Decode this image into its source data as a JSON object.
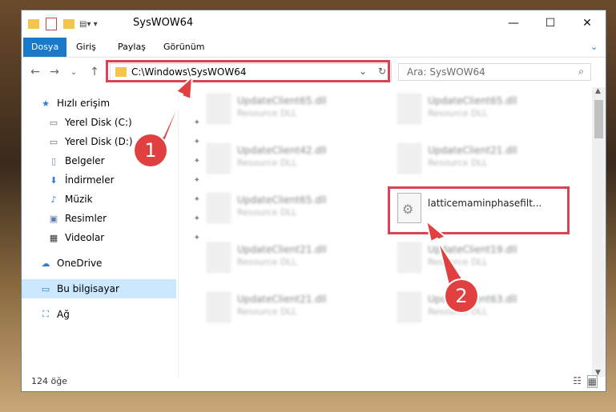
{
  "window": {
    "title": "SysWOW64"
  },
  "ribbon": {
    "tabs": [
      "Dosya",
      "Giriş",
      "Paylaş",
      "Görünüm"
    ]
  },
  "address": {
    "path": "C:\\Windows\\SysWOW64"
  },
  "search": {
    "placeholder": "Ara: SysWOW64"
  },
  "sidebar": {
    "items": [
      {
        "label": "Hızlı erişim"
      },
      {
        "label": "Yerel Disk (C:)"
      },
      {
        "label": "Yerel Disk (D:)"
      },
      {
        "label": "Belgeler"
      },
      {
        "label": "İndirmeler"
      },
      {
        "label": "Müzik"
      },
      {
        "label": "Resimler"
      },
      {
        "label": "Videolar"
      },
      {
        "label": "OneDrive"
      },
      {
        "label": "Bu bilgisayar"
      },
      {
        "label": "Ağ"
      }
    ]
  },
  "files": [
    {
      "name": "UpdateClient65.dll",
      "desc": "Resource DLL"
    },
    {
      "name": "UpdateClient65.dll",
      "desc": "Resource DLL"
    },
    {
      "name": "UpdateClient42.dll",
      "desc": "Resource DLL"
    },
    {
      "name": "UpdateClient21.dll",
      "desc": "Resource DLL"
    },
    {
      "name": "UpdateClient65.dll",
      "desc": "Resource DLL"
    },
    {
      "name": "latticemaminphasefilt...",
      "desc": ""
    },
    {
      "name": "UpdateClient21.dll",
      "desc": "Resource DLL"
    },
    {
      "name": "UpdateClient19.dll",
      "desc": "Resource DLL"
    },
    {
      "name": "UpdateClient21.dll",
      "desc": "Resource DLL"
    },
    {
      "name": "UpdateClient63.dll",
      "desc": "Resource DLL"
    }
  ],
  "status": {
    "count": "124 öğe"
  },
  "annotations": {
    "badge1": "1",
    "badge2": "2"
  },
  "colors": {
    "accent": "#1979ca",
    "highlight": "#d64551",
    "selected": "#cce8ff"
  }
}
